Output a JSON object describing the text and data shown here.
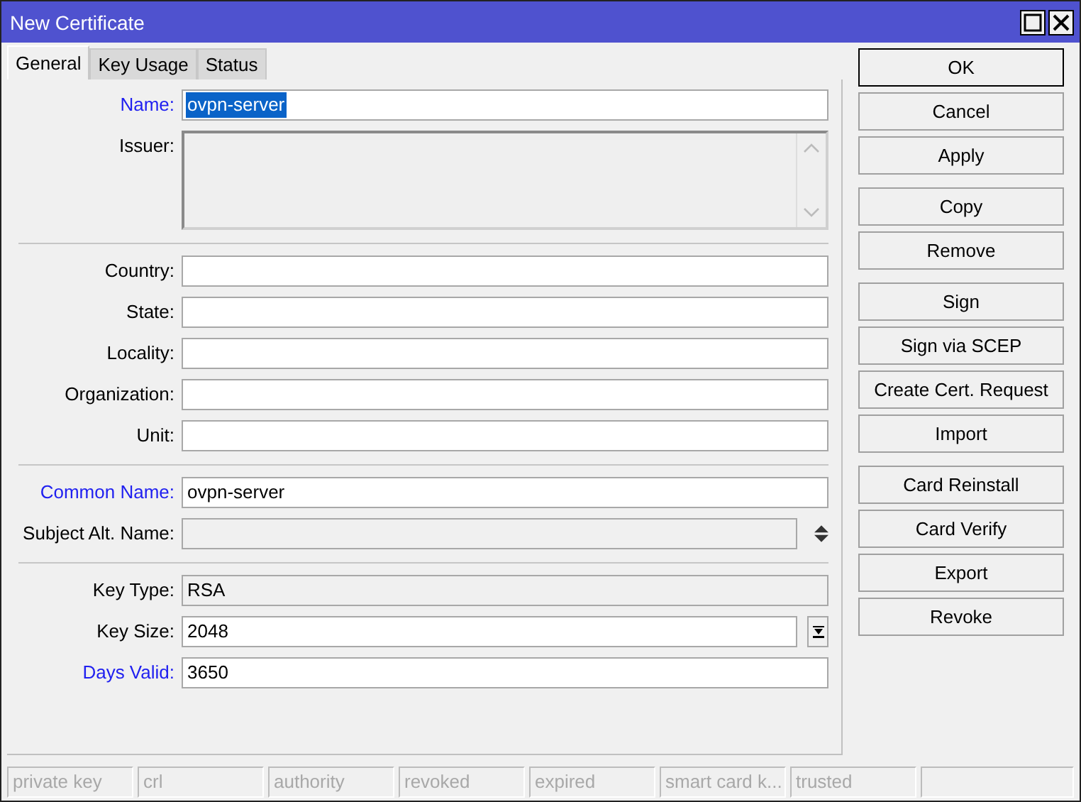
{
  "window": {
    "title": "New Certificate"
  },
  "tabs": [
    {
      "label": "General",
      "selected": true
    },
    {
      "label": "Key Usage",
      "selected": false
    },
    {
      "label": "Status",
      "selected": false
    }
  ],
  "sections": [
    [
      {
        "kind": "text",
        "label": "Name:",
        "value": "ovpn-server",
        "required": true,
        "disabled": false,
        "highlighted": true
      },
      {
        "kind": "multiline",
        "label": "Issuer:",
        "required": false,
        "disabled": true
      }
    ],
    [
      {
        "kind": "text",
        "label": "Country:",
        "required": false,
        "disabled": false
      },
      {
        "kind": "text",
        "label": "State:",
        "required": false,
        "disabled": false
      },
      {
        "kind": "text",
        "label": "Locality:",
        "required": false,
        "disabled": false
      },
      {
        "kind": "text",
        "label": "Organization:",
        "required": false,
        "disabled": false
      },
      {
        "kind": "text",
        "label": "Unit:",
        "required": false,
        "disabled": false
      }
    ],
    [
      {
        "kind": "text",
        "label": "Common Name:",
        "value": "ovpn-server",
        "required": true,
        "disabled": false,
        "highlighted": false
      },
      {
        "kind": "spinner",
        "label": "Subject Alt. Name:",
        "required": false,
        "disabled": true
      }
    ],
    [
      {
        "kind": "text",
        "label": "Key Type:",
        "value": "RSA",
        "required": false,
        "disabled": true,
        "highlighted": false
      },
      {
        "kind": "select",
        "label": "Key Size:",
        "value": "2048",
        "required": false,
        "disabled": false
      },
      {
        "kind": "text",
        "label": "Days Valid:",
        "value": "3650",
        "required": true,
        "disabled": false,
        "highlighted": false
      }
    ]
  ],
  "button_groups": [
    [
      {
        "label": "OK",
        "default": true
      },
      {
        "label": "Cancel",
        "default": false
      },
      {
        "label": "Apply",
        "default": false
      }
    ],
    [
      {
        "label": "Copy",
        "default": false
      },
      {
        "label": "Remove",
        "default": false
      }
    ],
    [
      {
        "label": "Sign",
        "default": false
      },
      {
        "label": "Sign via SCEP",
        "default": false
      },
      {
        "label": "Create Cert. Request",
        "default": false
      },
      {
        "label": "Import",
        "default": false
      }
    ],
    [
      {
        "label": "Card Reinstall",
        "default": false
      },
      {
        "label": "Card Verify",
        "default": false
      },
      {
        "label": "Export",
        "default": false
      },
      {
        "label": "Revoke",
        "default": false
      }
    ]
  ],
  "status_bar": [
    "private key",
    "crl",
    "authority",
    "revoked",
    "expired",
    "smart card k...",
    "trusted"
  ]
}
